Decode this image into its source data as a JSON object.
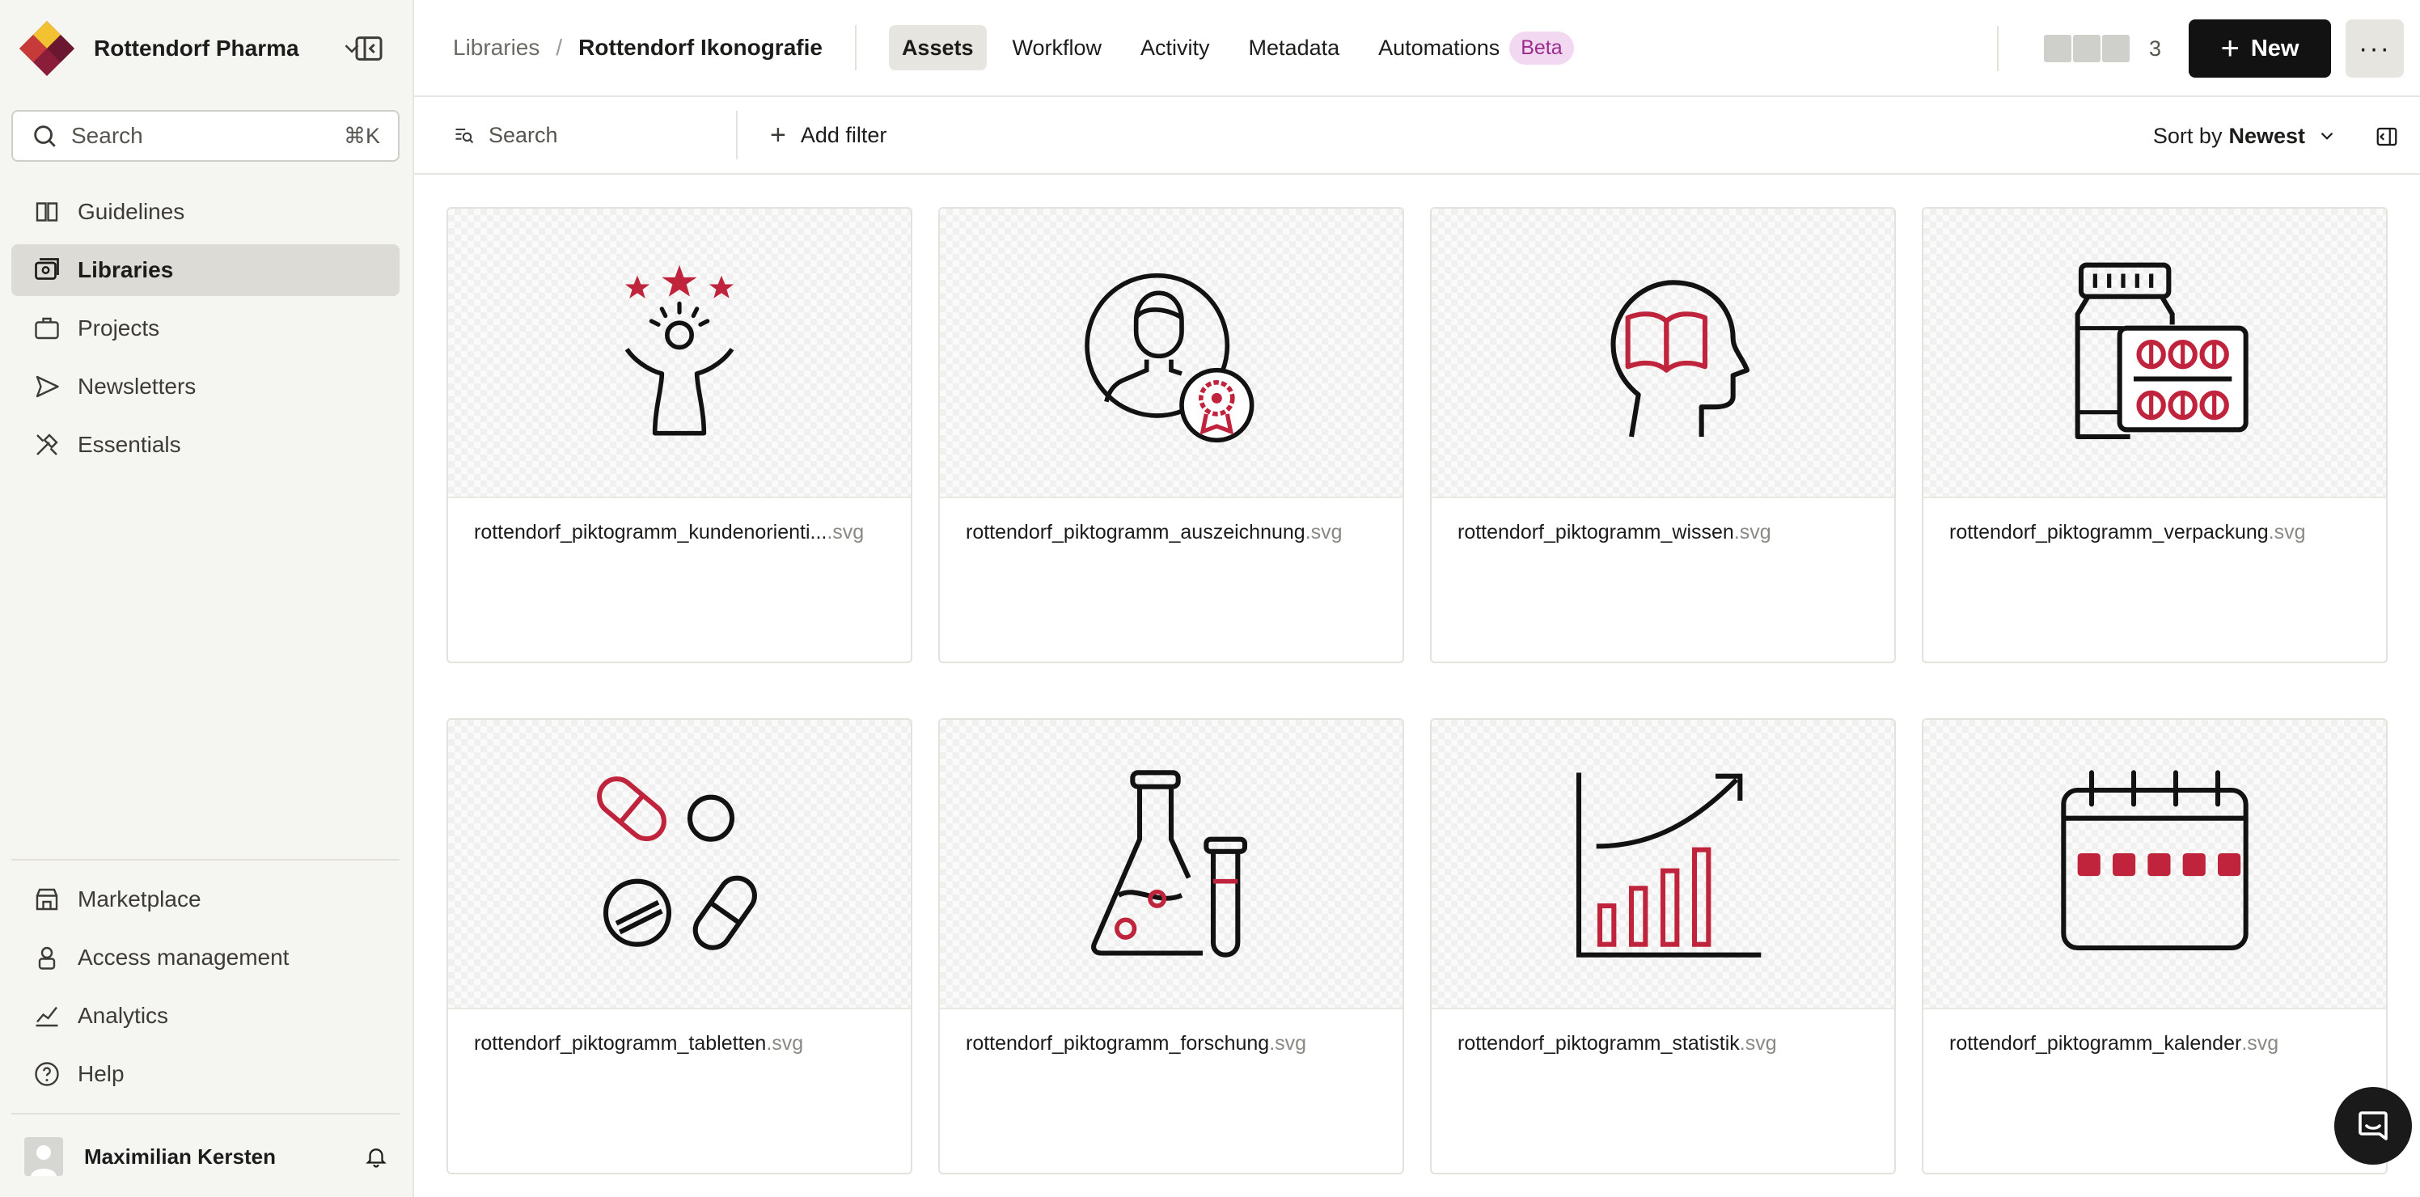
{
  "workspace": {
    "name": "Rottendorf Pharma"
  },
  "search": {
    "placeholder": "Search",
    "shortcut": "⌘K"
  },
  "sidebar": {
    "top_items": [
      {
        "label": "Guidelines",
        "icon": "guidelines-icon"
      },
      {
        "label": "Libraries",
        "icon": "libraries-icon",
        "active": true
      },
      {
        "label": "Projects",
        "icon": "projects-icon"
      },
      {
        "label": "Newsletters",
        "icon": "newsletters-icon"
      },
      {
        "label": "Essentials",
        "icon": "essentials-icon"
      }
    ],
    "bottom_items": [
      {
        "label": "Marketplace",
        "icon": "marketplace-icon"
      },
      {
        "label": "Access management",
        "icon": "access-icon"
      },
      {
        "label": "Analytics",
        "icon": "analytics-icon"
      },
      {
        "label": "Help",
        "icon": "help-icon"
      }
    ],
    "user": {
      "name": "Maximilian Kersten"
    }
  },
  "header": {
    "breadcrumb": [
      "Libraries",
      "Rottendorf Ikonografie"
    ],
    "separator": "/",
    "tabs": [
      "Assets",
      "Workflow",
      "Activity",
      "Metadata",
      "Automations"
    ],
    "beta": "Beta",
    "member_count": "3",
    "new_label": "New"
  },
  "filter": {
    "search": "Search",
    "add_filter": "Add filter",
    "sort_prefix": "Sort by",
    "sort_value": "Newest"
  },
  "assets": [
    {
      "base": "rottendorf_piktogramm_kundenorienti...",
      "ext": ".svg"
    },
    {
      "base": "rottendorf_piktogramm_auszeichnung",
      "ext": ".svg"
    },
    {
      "base": "rottendorf_piktogramm_wissen",
      "ext": ".svg"
    },
    {
      "base": "rottendorf_piktogramm_verpackung",
      "ext": ".svg"
    },
    {
      "base": "rottendorf_piktogramm_tabletten",
      "ext": ".svg"
    },
    {
      "base": "rottendorf_piktogramm_forschung",
      "ext": ".svg"
    },
    {
      "base": "rottendorf_piktogramm_statistik",
      "ext": ".svg"
    },
    {
      "base": "rottendorf_piktogramm_kalender",
      "ext": ".svg"
    }
  ],
  "colors": {
    "accent": "#c0243d",
    "ink": "#121212",
    "beta_bg": "#f2d8f0",
    "beta_fg": "#9b2b8c"
  }
}
